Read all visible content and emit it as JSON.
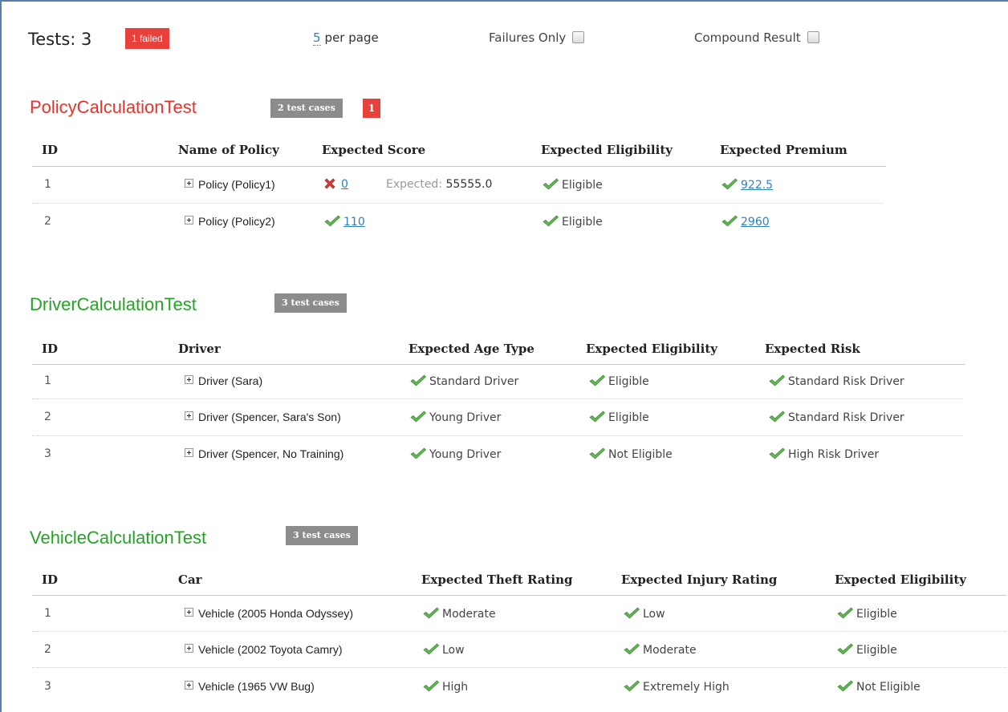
{
  "header": {
    "tests_label": "Tests: 3",
    "failed_badge": "1 failed",
    "per_page_count": "5",
    "per_page_label": "per page",
    "failures_only_label": "Failures Only",
    "compound_result_label": "Compound Result"
  },
  "policy": {
    "title": "PolicyCalculationTest",
    "cases_badge": "2 test cases",
    "failed_count": "1",
    "columns": [
      "ID",
      "Name of Policy",
      "Expected Score",
      "Expected Eligibility",
      "Expected Premium"
    ],
    "rows": [
      {
        "id": "1",
        "name": "Policy (Policy1)",
        "score": "0",
        "expected_label": "Expected:",
        "expected_value": "55555.0",
        "eligibility": "Eligible",
        "premium": "922.5"
      },
      {
        "id": "2",
        "name": "Policy (Policy2)",
        "score": "110",
        "eligibility": "Eligible",
        "premium": "2960"
      }
    ]
  },
  "driver": {
    "title": "DriverCalculationTest",
    "cases_badge": "3 test cases",
    "columns": [
      "ID",
      "Driver",
      "Expected Age Type",
      "Expected Eligibility",
      "Expected Risk"
    ],
    "rows": [
      {
        "id": "1",
        "name": "Driver (Sara)",
        "age_type": "Standard Driver",
        "eligibility": "Eligible",
        "risk": "Standard Risk Driver"
      },
      {
        "id": "2",
        "name": "Driver (Spencer, Sara's Son)",
        "age_type": "Young Driver",
        "eligibility": "Eligible",
        "risk": "Standard Risk Driver"
      },
      {
        "id": "3",
        "name": "Driver (Spencer, No Training)",
        "age_type": "Young Driver",
        "eligibility": "Not Eligible",
        "risk": "High Risk Driver"
      }
    ]
  },
  "vehicle": {
    "title": "VehicleCalculationTest",
    "cases_badge": "3 test cases",
    "columns": [
      "ID",
      "Car",
      "Expected Theft Rating",
      "Expected Injury Rating",
      "Expected Eligibility"
    ],
    "rows": [
      {
        "id": "1",
        "name": "Vehicle (2005 Honda Odyssey)",
        "theft": "Moderate",
        "injury": "Low",
        "eligibility": "Eligible"
      },
      {
        "id": "2",
        "name": "Vehicle (2002 Toyota Camry)",
        "theft": "Low",
        "injury": "Moderate",
        "eligibility": "Eligible"
      },
      {
        "id": "3",
        "name": "Vehicle (1965 VW Bug)",
        "theft": "High",
        "injury": "Extremely High",
        "eligibility": "Not Eligible"
      }
    ]
  },
  "colors": {
    "failed": "#e8403a",
    "passed_title": "#24a424",
    "failed_title": "#e8332c",
    "link": "#3080c0",
    "check": "#5cb85c"
  }
}
